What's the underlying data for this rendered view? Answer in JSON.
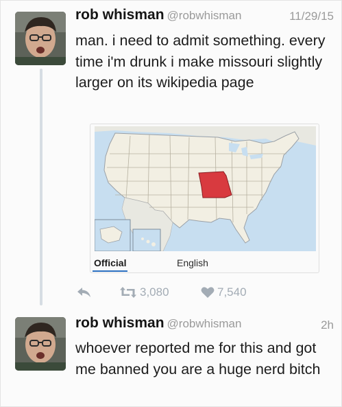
{
  "tweets": [
    {
      "author_name": "rob whisman",
      "handle": "@robwhisman",
      "timestamp": "11/29/15",
      "text": "man. i need to admit something. every time i'm drunk i make missouri slightly larger on its wikipedia page",
      "media": {
        "tabs": [
          "Official",
          "English"
        ],
        "selected_tab": "Official",
        "highlight_color": "#d83a3f"
      },
      "actions": {
        "reply_icon": "reply-icon",
        "retweet_icon": "retweet-icon",
        "like_icon": "heart-icon",
        "retweet_count": "3,080",
        "like_count": "7,540"
      }
    },
    {
      "author_name": "rob whisman",
      "handle": "@robwhisman",
      "timestamp": "2h",
      "text": "whoever reported me for this and got me banned you are a huge nerd bitch"
    }
  ],
  "colors": {
    "action_icon": "#a3acb5",
    "handle_text": "#9a9a9a",
    "thread_line": "#d6dde3"
  }
}
